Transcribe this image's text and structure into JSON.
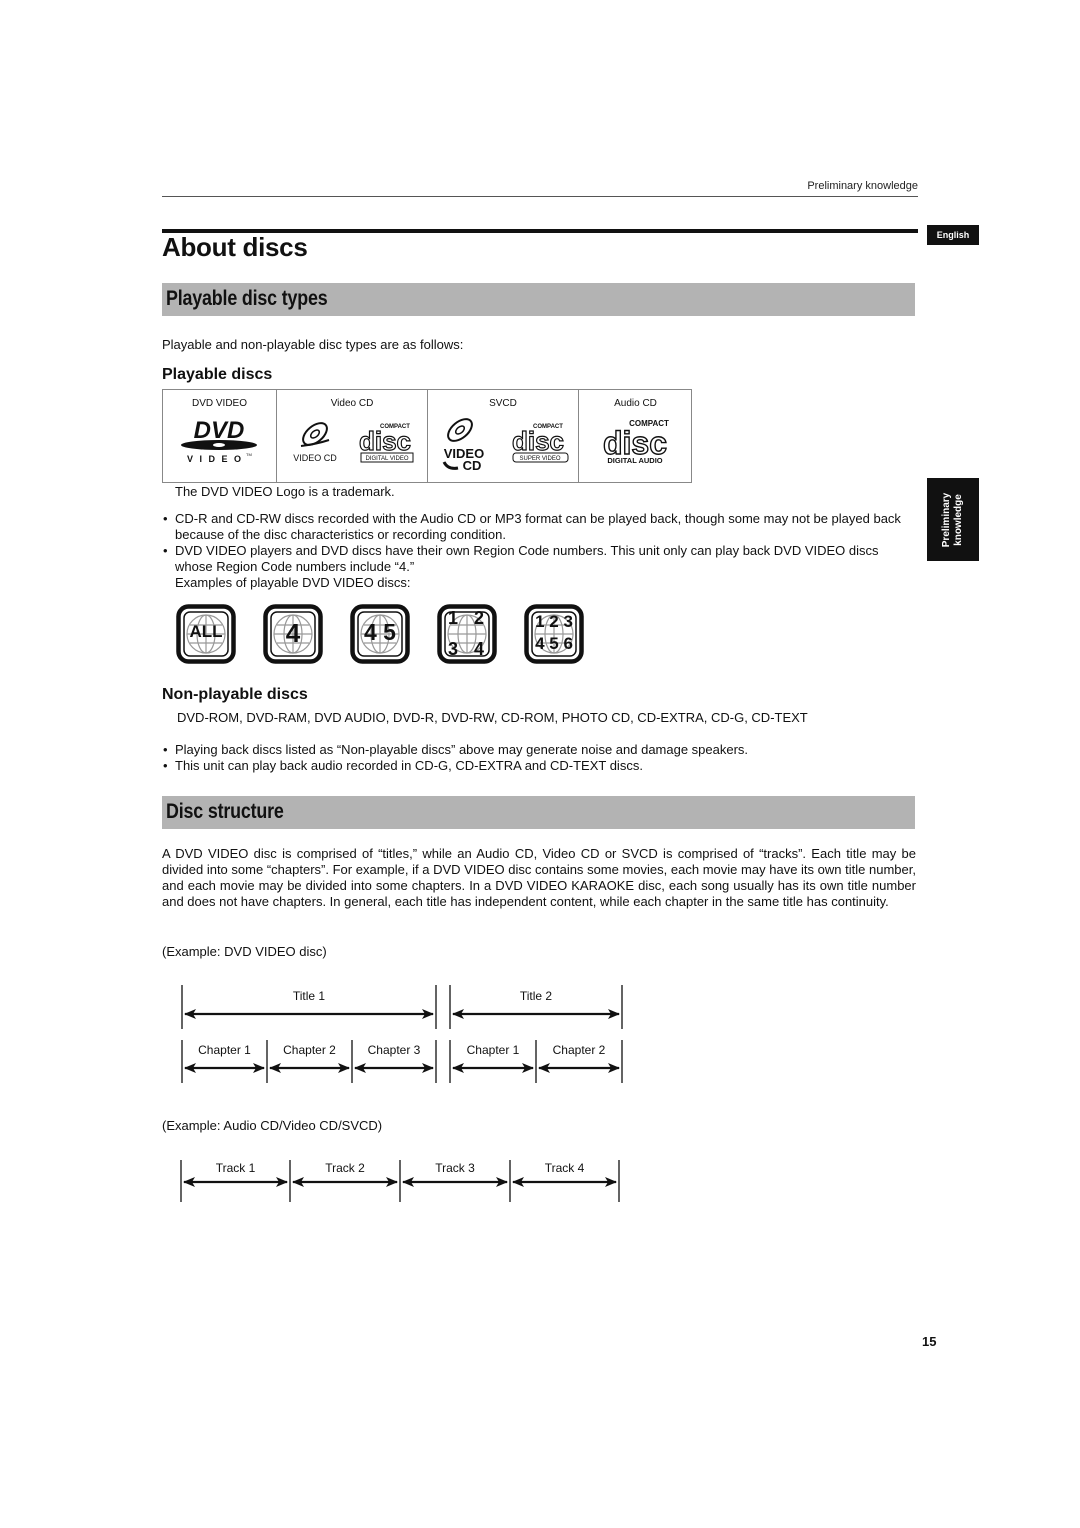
{
  "header": {
    "running_head": "Preliminary knowledge",
    "language_tab": "English",
    "side_tab_line1": "Preliminary",
    "side_tab_line2": "knowledge",
    "page_number": "15"
  },
  "page_title": "About discs",
  "section1": {
    "title": "Playable disc types",
    "intro": "Playable and non-playable disc types are as follows:",
    "playable_heading": "Playable discs",
    "disc_table": [
      {
        "label": "DVD VIDEO",
        "logos": [
          "dvd-video-logo"
        ]
      },
      {
        "label": "Video CD",
        "logos": [
          "video-cd-logo",
          "compact-disc-digital-video-logo"
        ],
        "sub_labels": [
          "VIDEO CD",
          "DIGITAL VIDEO"
        ]
      },
      {
        "label": "SVCD",
        "logos": [
          "video-cd-logo",
          "compact-disc-super-video-logo"
        ],
        "sub_labels": [
          "SUPER VIDEO"
        ]
      },
      {
        "label": "Audio CD",
        "logos": [
          "compact-disc-digital-audio-logo"
        ],
        "sub_labels": [
          "DIGITAL AUDIO"
        ]
      }
    ],
    "logo_text": {
      "dvd": "DVD",
      "video_spaced": "V I D E O",
      "tm": "TM",
      "compact": "COMPACT",
      "disc": "disc",
      "video_cd_word1": "VIDEO",
      "video_cd_word2": "CD"
    },
    "trademark_note": "The DVD VIDEO Logo is a trademark.",
    "bullets": [
      "CD-R and CD-RW discs recorded with the Audio CD or MP3 format can be played back, though some may not be played back because of the disc characteristics or recording condition.",
      "DVD VIDEO players and DVD discs have their own Region Code numbers. This unit only can play back DVD VIDEO discs whose Region Code numbers include “4.”"
    ],
    "examples_label": "Examples of playable DVD VIDEO discs:",
    "region_codes": [
      {
        "label": "ALL",
        "rows": [
          [
            "ALL"
          ]
        ]
      },
      {
        "label": "4",
        "rows": [
          [
            "4"
          ]
        ]
      },
      {
        "label": "4 5",
        "rows": [
          [
            "4 5"
          ]
        ]
      },
      {
        "label": "1 2 3 4",
        "rows": [
          [
            "1",
            "2"
          ],
          [
            "3",
            "4"
          ]
        ]
      },
      {
        "label": "1 2 3 4 5 6",
        "rows": [
          [
            "1 2 3"
          ],
          [
            "4 5 6"
          ]
        ]
      }
    ],
    "non_playable_heading": "Non-playable discs",
    "non_playable_list": "DVD-ROM, DVD-RAM, DVD AUDIO, DVD-R, DVD-RW, CD-ROM, PHOTO CD, CD-EXTRA, CD-G, CD-TEXT",
    "non_playable_bullets": [
      "Playing back discs listed as “Non-playable discs” above may generate noise and damage speakers.",
      "This unit can play back audio recorded in CD-G, CD-EXTRA and CD-TEXT discs."
    ]
  },
  "section2": {
    "title": "Disc structure",
    "paragraph": "A DVD VIDEO disc is comprised of “titles,” while an Audio CD, Video CD or SVCD is comprised of “tracks”. Each title may be divided into some “chapters”. For example, if a DVD VIDEO disc contains some movies, each movie may have its own title number, and each movie may be divided into some chapters. In a DVD VIDEO KARAOKE disc, each song usually has its own title number and does not have chapters. In general, each title has independent content, while each chapter in the same title has continuity.",
    "example_dvd": "(Example: DVD VIDEO disc)",
    "dvd_titles": [
      {
        "label": "Title 1",
        "chapters": [
          "Chapter 1",
          "Chapter 2",
          "Chapter 3"
        ]
      },
      {
        "label": "Title 2",
        "chapters": [
          "Chapter 1",
          "Chapter 2"
        ]
      }
    ],
    "example_cd": "(Example: Audio CD/Video CD/SVCD)",
    "cd_tracks": [
      "Track 1",
      "Track 2",
      "Track 3",
      "Track 4"
    ]
  }
}
